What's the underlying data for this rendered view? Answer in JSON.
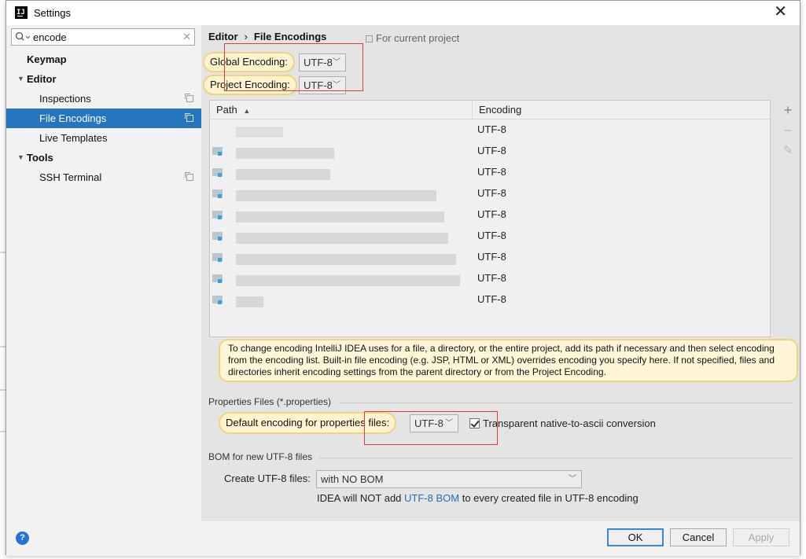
{
  "window": {
    "title": "Settings"
  },
  "search": {
    "value": "encode"
  },
  "sidebar": {
    "items": [
      {
        "label": "Keymap"
      },
      {
        "label": "Editor"
      },
      {
        "label": "Inspections"
      },
      {
        "label": "File Encodings"
      },
      {
        "label": "Live Templates"
      },
      {
        "label": "Tools"
      },
      {
        "label": "SSH Terminal"
      }
    ]
  },
  "breadcrumb": {
    "parent": "Editor",
    "current": "File Encodings"
  },
  "scope_hint": "For current project",
  "global_encoding": {
    "label": "Global Encoding:",
    "value": "UTF-8"
  },
  "project_encoding": {
    "label": "Project Encoding:",
    "value": "UTF-8"
  },
  "table": {
    "columns": [
      "Path",
      "Encoding"
    ],
    "sort_indicator": "▲",
    "rows": [
      {
        "encoding": "UTF-8"
      },
      {
        "encoding": "UTF-8"
      },
      {
        "encoding": "UTF-8"
      },
      {
        "encoding": "UTF-8"
      },
      {
        "encoding": "UTF-8"
      },
      {
        "encoding": "UTF-8"
      },
      {
        "encoding": "UTF-8"
      },
      {
        "encoding": "UTF-8"
      },
      {
        "encoding": "UTF-8"
      }
    ]
  },
  "toolbar": {
    "add": "+",
    "remove": "−",
    "edit": "✎"
  },
  "info_text": "To change encoding IntelliJ IDEA uses for a file, a directory, or the entire project, add its path if necessary and then select encoding from the encoding list. Built-in file encoding (e.g. JSP, HTML or XML) overrides encoding you specify here. If not specified, files and directories inherit encoding settings from the parent directory or from the Project Encoding.",
  "properties": {
    "section_title": "Properties Files (*.properties)",
    "default_label": "Default encoding for properties files:",
    "default_value": "UTF-8",
    "transparent_label": "Transparent native-to-ascii conversion",
    "transparent_checked": true
  },
  "bom": {
    "section_title": "BOM for new UTF-8 files",
    "create_label": "Create UTF-8 files:",
    "create_value": "with NO BOM",
    "note_prefix": "IDEA will NOT add ",
    "note_link": "UTF-8 BOM",
    "note_suffix": " to every created file in UTF-8 encoding"
  },
  "footer": {
    "help": "?",
    "ok": "OK",
    "cancel": "Cancel",
    "apply": "Apply"
  },
  "colors": {
    "selection": "#2675bf",
    "highlight_border": "#f0d37b",
    "annotation_red": "#e33b3b",
    "link": "#2470b3"
  }
}
